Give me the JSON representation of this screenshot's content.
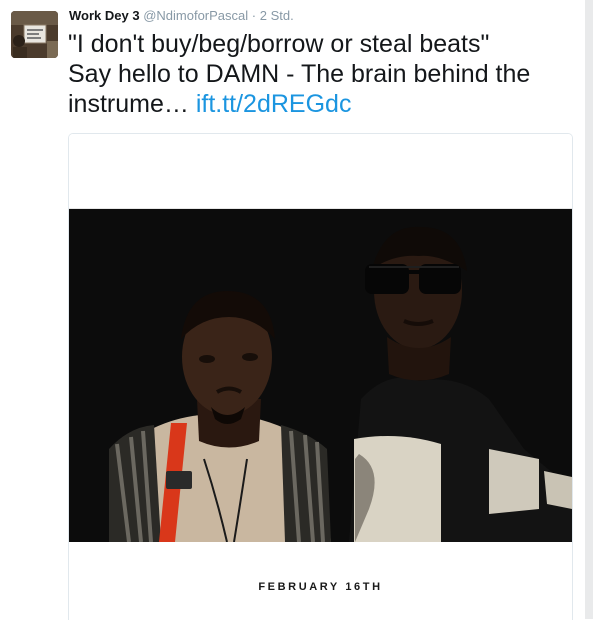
{
  "tweet": {
    "author_name": "Work Dey 3",
    "handle": "@NdimoforPascal",
    "separator": "·",
    "timestamp": "2 Std.",
    "text_line_1": "\"I don't buy/beg/borrow or steal beats\"",
    "text_line_2": "Say hello to DAMN - The brain behind the",
    "text_line_3": "instrume…",
    "link_text": "ift.tt/2dREGdc",
    "colors": {
      "link": "#1b95e0",
      "meta": "#8899a6",
      "text": "#14171a"
    }
  },
  "card": {
    "date_text": "FEBRUARY 16TH"
  },
  "icons": {
    "avatar": "user-avatar-photo"
  }
}
